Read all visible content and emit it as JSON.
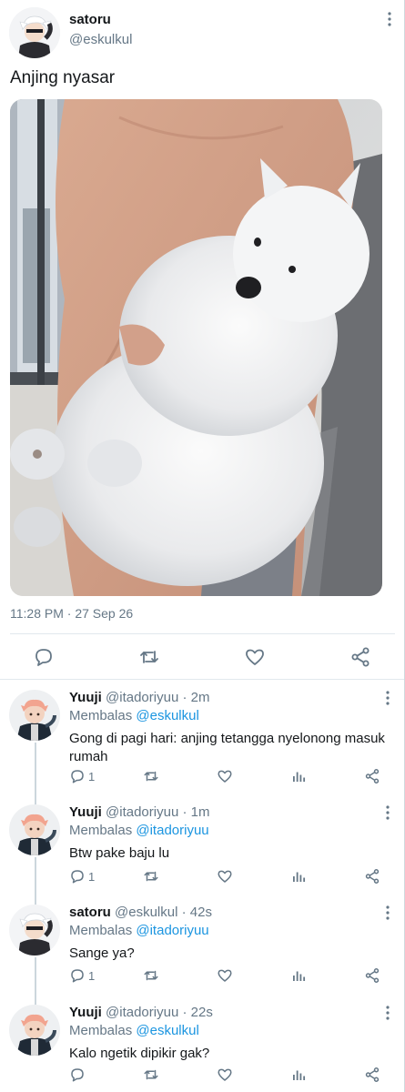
{
  "tweet": {
    "display_name": "satoru",
    "handle": "@eskulkul",
    "text": "Anjing nyasar",
    "timestamp": "11:28 PM · 27 Sep 26",
    "avatar_icon": "avatar-white-hair",
    "photo_icon": "photo-samoyed-held"
  },
  "replies": [
    {
      "display_name": "Yuuji",
      "handle": "@itadoriyuu",
      "sep": "·",
      "time": "2m",
      "replying_prefix": "Membalas",
      "replying_to": "@eskulkul",
      "text": "Gong di pagi hari: anjing tetangga nyelonong masuk rumah",
      "reply_count": "1"
    },
    {
      "display_name": "Yuuji",
      "handle": "@itadoriyuu",
      "sep": "·",
      "time": "1m",
      "replying_prefix": "Membalas",
      "replying_to": "@itadoriyuu",
      "text": "Btw pake baju lu",
      "reply_count": "1"
    },
    {
      "display_name": "satoru",
      "handle": "@eskulkul",
      "sep": "·",
      "time": "42s",
      "replying_prefix": "Membalas",
      "replying_to": "@itadoriyuu",
      "text": "Sange ya?",
      "reply_count": "1"
    },
    {
      "display_name": "Yuuji",
      "handle": "@itadoriyuu",
      "sep": "·",
      "time": "22s",
      "replying_prefix": "Membalas",
      "replying_to": "@eskulkul",
      "text": "Kalo ngetik dipikir gak?",
      "reply_count": ""
    }
  ],
  "colors": {
    "text_primary": "#14171a",
    "text_secondary": "#657786",
    "link": "#1b95e0",
    "divider": "#e1e8ed"
  }
}
